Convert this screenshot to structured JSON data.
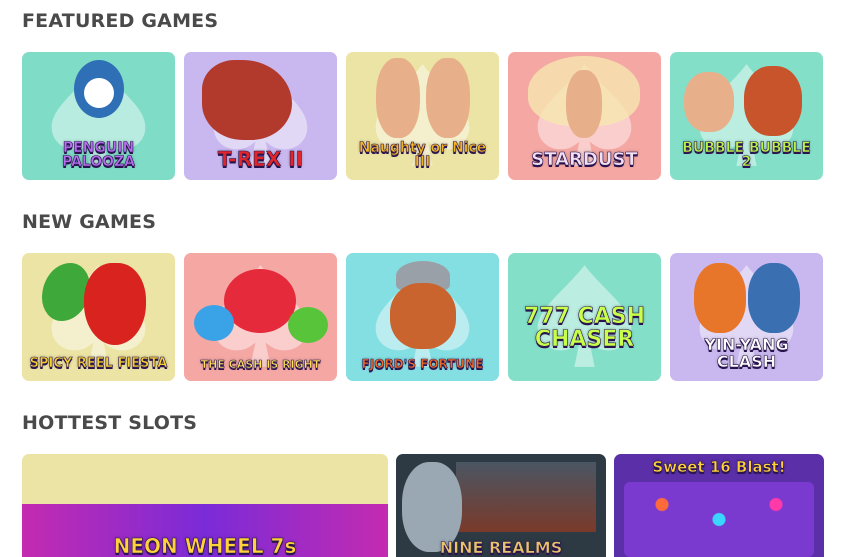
{
  "sections": {
    "featured": {
      "title": "FEATURED GAMES",
      "games": [
        {
          "label": "PENGUIN PALOOZA",
          "bg": "#7fdcc7",
          "text_color": "#b86df0"
        },
        {
          "label": "T-REX II",
          "bg": "#c9b8ef",
          "text_color": "#e0262b"
        },
        {
          "label": "Naughty or Nice III",
          "bg": "#ece4a4",
          "text_color": "#f4b424"
        },
        {
          "label": "STARDUST",
          "bg": "#f4a7a3",
          "text_color": "#f3dff2"
        },
        {
          "label": "BUBBLE BUBBLE 2",
          "bg": "#84dfc9",
          "text_color": "#b9f04a"
        }
      ]
    },
    "new": {
      "title": "NEW GAMES",
      "games": [
        {
          "label": "SPICY REEL FIESTA",
          "bg": "#ece4a4",
          "text_color": "#f7d030"
        },
        {
          "label": "THE CASH IS RIGHT",
          "bg": "#f4a7a3",
          "text_color": "#ffe35a"
        },
        {
          "label": "FJORD'S FORTUNE",
          "bg": "#84dfe3",
          "text_color": "#f06a2a"
        },
        {
          "label": "777 CASH CHASER",
          "bg": "#84dfc9",
          "text_color": "#c7ff4a"
        },
        {
          "label": "YIN-YANG CLASH",
          "bg": "#c9b8ef",
          "text_color": "#ffffff"
        }
      ]
    },
    "hottest": {
      "title": "HOTTEST SLOTS",
      "games": [
        {
          "label": "NEON WHEEL 7s",
          "bg": "#ece4a4",
          "text_color": "#ffd23a"
        },
        {
          "label": "NINE REALMS",
          "bg": "#2d3a44",
          "text_color": "#e8c36a"
        },
        {
          "label": "Sweet 16 Blast!",
          "bg": "#5a2fa8",
          "text_color": "#ffd23a"
        }
      ]
    }
  }
}
